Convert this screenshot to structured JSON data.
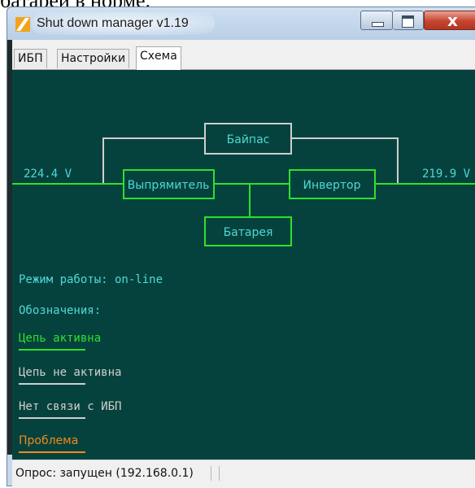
{
  "caption": "батареи в норме.",
  "window": {
    "title": "Shut down manager  v1.19",
    "controls": {
      "minimize": "minimize-icon",
      "maximize": "maximize-icon",
      "close": "close-icon"
    }
  },
  "tabs": [
    {
      "label": "ИБП",
      "active": false
    },
    {
      "label": "Настройки",
      "active": false
    },
    {
      "label": "Схема",
      "active": true
    }
  ],
  "schema": {
    "input_voltage": "224.4 V",
    "output_voltage": "219.9 V",
    "blocks": {
      "bypass": "Байпас",
      "rectifier": "Выпрямитель",
      "inverter": "Инвертор",
      "battery": "Батарея"
    },
    "mode_text": "Режим работы: on-line",
    "legend_title": "Обозначения:",
    "legend": {
      "active": "Цепь активна",
      "inactive": "Цепь не активна",
      "no_link": "Нет связи с ИБП",
      "problem": "Проблема"
    },
    "colors": {
      "background": "#06423d",
      "active": "#2ee02e",
      "inactive": "#cfcfcf",
      "text": "#4fd8d8",
      "problem": "#f08a1c"
    }
  },
  "status": {
    "polling": "Опрос: запущен (192.168.0.1)"
  }
}
